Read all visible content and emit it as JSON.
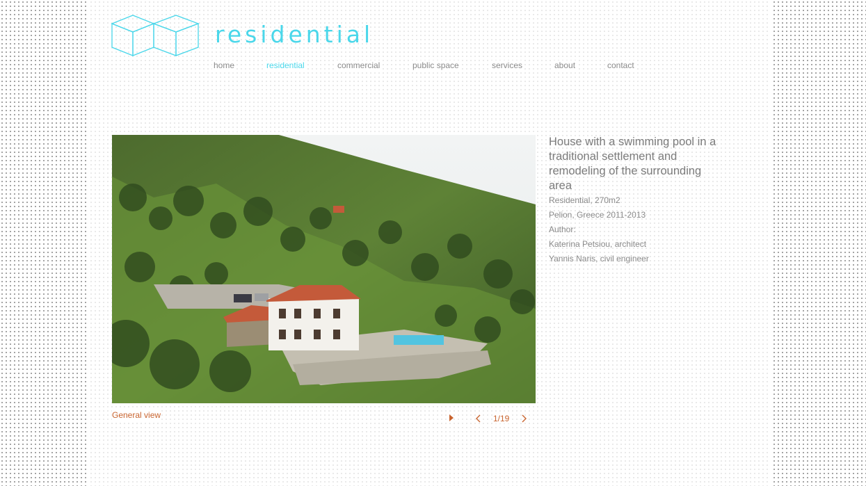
{
  "header": {
    "section_title": "residential"
  },
  "nav": {
    "items": [
      {
        "label": "home"
      },
      {
        "label": "residential"
      },
      {
        "label": "commercial"
      },
      {
        "label": "public space"
      },
      {
        "label": "services"
      },
      {
        "label": "about"
      },
      {
        "label": "contact"
      }
    ]
  },
  "project": {
    "title": "House with a swimming pool in a traditional settlement and remodeling of the surrounding area",
    "category": "Residential, 270m2",
    "location": "Pelion, Greece 2011-2013",
    "author_label": "Author:",
    "authors": [
      "Katerina Petsiou, architect",
      "Yannis Naris, civil engineer"
    ]
  },
  "gallery": {
    "caption": "General view",
    "counter": "1/19"
  },
  "colors": {
    "accent": "#4ad7ea",
    "link": "#c8642f",
    "text": "#8a8a8a"
  },
  "icons": {
    "play": "play-icon",
    "prev": "chevron-left-icon",
    "next": "chevron-right-icon"
  }
}
